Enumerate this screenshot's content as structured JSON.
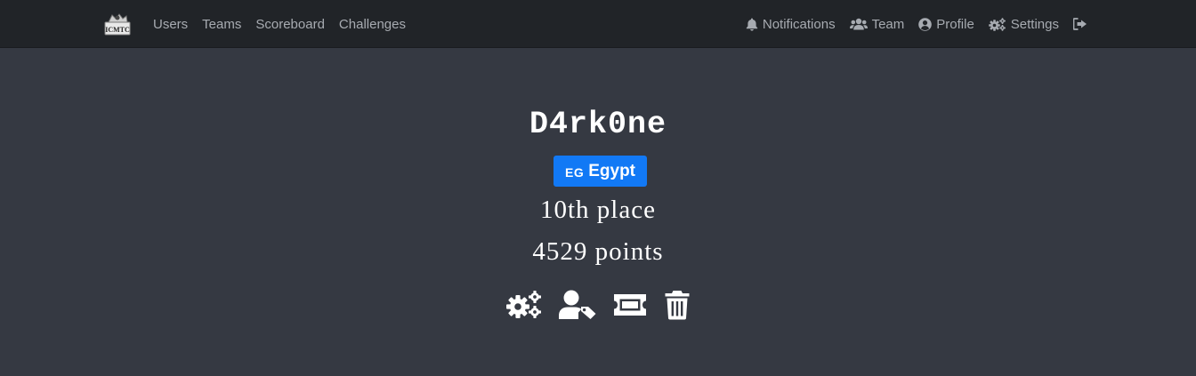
{
  "navbar": {
    "logo_text": "ICMTC",
    "left_links": [
      {
        "label": "Users"
      },
      {
        "label": "Teams"
      },
      {
        "label": "Scoreboard"
      },
      {
        "label": "Challenges"
      }
    ],
    "right_links": [
      {
        "label": "Notifications",
        "icon": "bell-icon"
      },
      {
        "label": "Team",
        "icon": "users-icon"
      },
      {
        "label": "Profile",
        "icon": "user-circle-icon"
      },
      {
        "label": "Settings",
        "icon": "cogs-icon"
      }
    ],
    "logout_icon": "sign-out-icon"
  },
  "profile": {
    "username": "D4rk0ne",
    "country_code": "EG",
    "country_name": "Egypt",
    "place": "10th place",
    "points": "4529 points",
    "actions": [
      {
        "icon": "cogs-icon"
      },
      {
        "icon": "user-tag-icon"
      },
      {
        "icon": "ticket-icon"
      },
      {
        "icon": "trash-icon"
      }
    ]
  },
  "colors": {
    "background": "#353942",
    "navbar": "#212428",
    "nav_text": "#a7abb1",
    "badge": "#1279f5",
    "text": "#ffffff"
  }
}
